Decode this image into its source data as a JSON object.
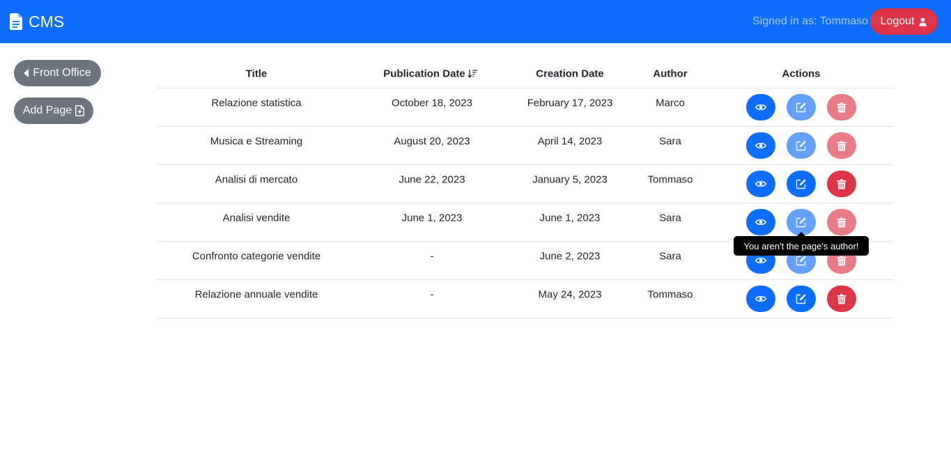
{
  "navbar": {
    "brand": "CMS",
    "brand_icon": "document-icon",
    "signed_in_text": "Signed in as: Tommaso",
    "logout_label": "Logout",
    "logout_icon": "person-icon",
    "color": "#0d6efd"
  },
  "sidebar": {
    "front_office_label": "Front Office",
    "add_page_label": "Add Page"
  },
  "table": {
    "headers": {
      "title": "Title",
      "publication_date": "Publication Date",
      "creation_date": "Creation Date",
      "author": "Author",
      "actions": "Actions"
    },
    "sort_icon": "sort-down-icon",
    "rows": [
      {
        "title": "Relazione statistica",
        "publication_date": "October 18, 2023",
        "creation_date": "February 17, 2023",
        "author": "Marco",
        "can_edit": false
      },
      {
        "title": "Musica e Streaming",
        "publication_date": "August 20, 2023",
        "creation_date": "April 14, 2023",
        "author": "Sara",
        "can_edit": false
      },
      {
        "title": "Analisi di mercato",
        "publication_date": "June 22, 2023",
        "creation_date": "January 5, 2023",
        "author": "Tommaso",
        "can_edit": true
      },
      {
        "title": "Analisi vendite",
        "publication_date": "June 1, 2023",
        "creation_date": "June 1, 2023",
        "author": "Sara",
        "can_edit": false
      },
      {
        "title": "Confronto categorie vendite",
        "publication_date": "-",
        "creation_date": "June 2, 2023",
        "author": "Sara",
        "can_edit": false
      },
      {
        "title": "Relazione annuale vendite",
        "publication_date": "-",
        "creation_date": "May 24, 2023",
        "author": "Tommaso",
        "can_edit": true
      }
    ]
  },
  "tooltip": {
    "text": "You aren't the page's author!"
  },
  "colors": {
    "primary": "#0d6efd",
    "danger": "#dc3545",
    "secondary": "#6c757d"
  }
}
